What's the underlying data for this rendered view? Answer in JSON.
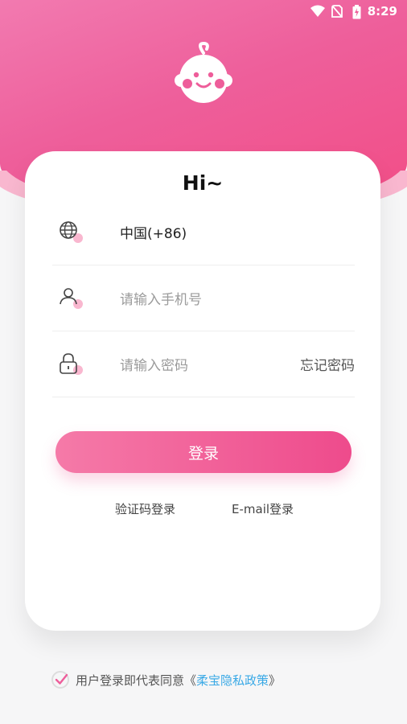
{
  "status_bar": {
    "time": "8:29",
    "icons": [
      "wifi-icon",
      "no-sim-icon",
      "battery-charging-icon"
    ]
  },
  "header": {
    "logo": "baby-face-logo",
    "colors": {
      "primary": "#f06aa8",
      "wave": "#f9b7cf"
    }
  },
  "card": {
    "title": "Hi~",
    "region": {
      "icon": "globe-icon",
      "value": "中国(+86)"
    },
    "phone": {
      "icon": "user-icon",
      "placeholder": "请输入手机号"
    },
    "password": {
      "icon": "lock-icon",
      "placeholder": "请输入密码",
      "forgot_label": "忘记密码"
    },
    "login_button": "登录",
    "sms_login": "验证码登录",
    "email_login": "E-mail登录"
  },
  "agreement": {
    "checked": true,
    "text": "用户登录即代表同意",
    "open_quote": "《",
    "policy": "柔宝隐私政策",
    "close_quote": "》",
    "policy_color": "#3aa9e6"
  }
}
